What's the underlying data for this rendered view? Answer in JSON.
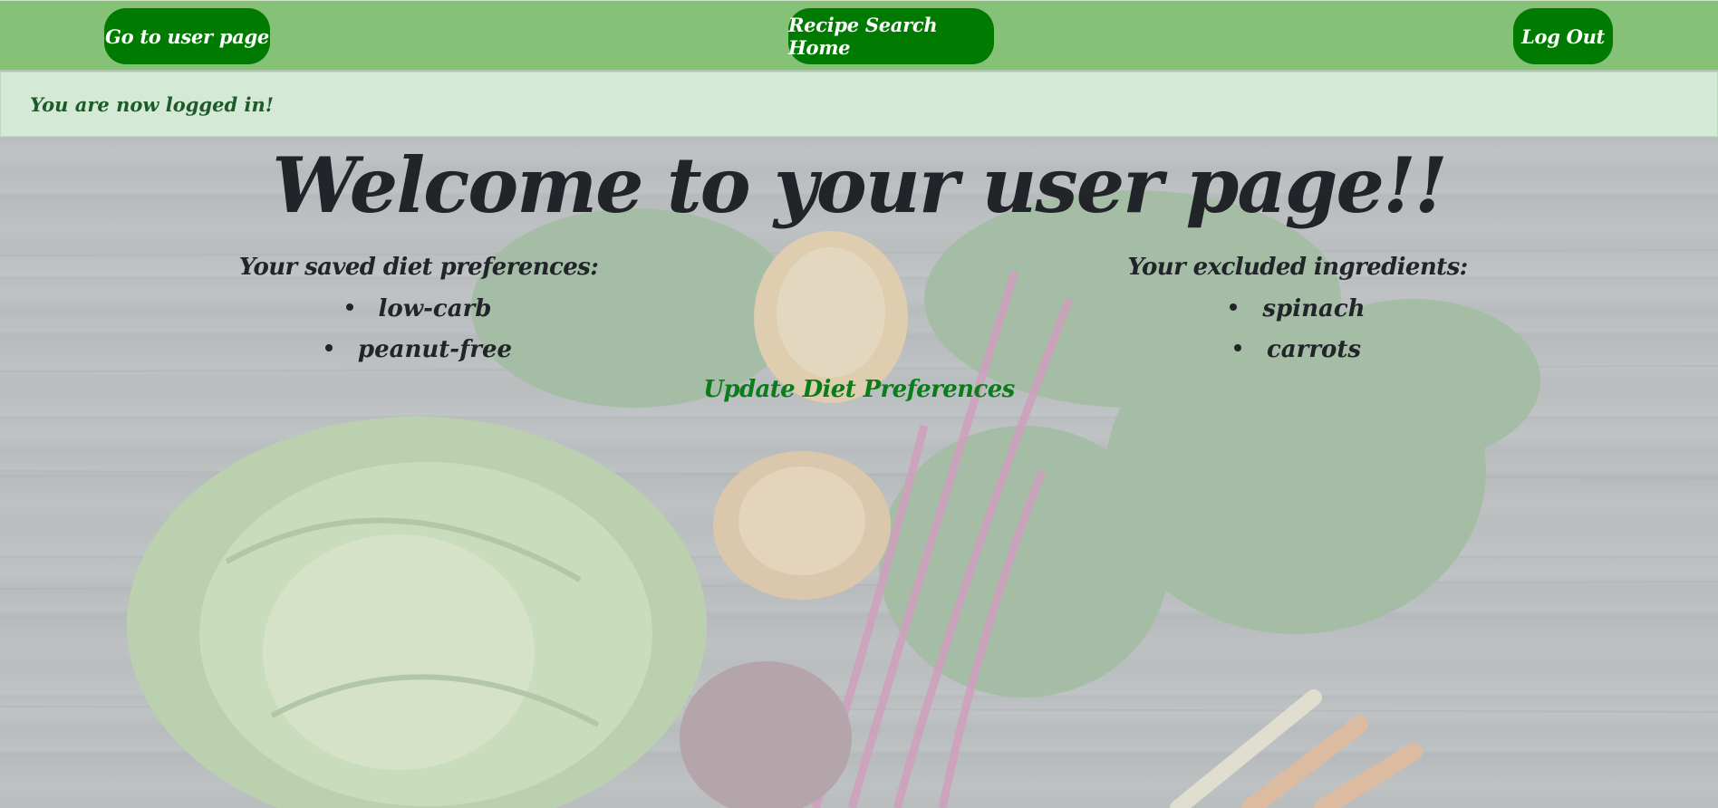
{
  "navbar": {
    "user_page_label": "Go to user page",
    "home_label": "Recipe Search Home",
    "logout_label": "Log Out"
  },
  "alert": {
    "message": "You are now logged in!"
  },
  "main": {
    "title": "Welcome to your user page!!",
    "diet": {
      "heading": "Your saved diet preferences:",
      "items": [
        "low-carb",
        "peanut-free"
      ]
    },
    "excluded": {
      "heading": "Your excluded ingredients:",
      "items": [
        "spinach",
        "carrots"
      ]
    },
    "update_link": "Update Diet Preferences"
  },
  "colors": {
    "navbar_bg": "#86c178",
    "button_bg": "#007a00",
    "alert_bg": "#d4ead6",
    "alert_text": "#1f5a2a",
    "link": "#0a7d1a",
    "text": "#212529"
  }
}
